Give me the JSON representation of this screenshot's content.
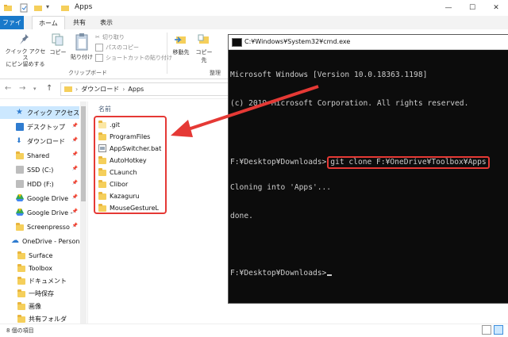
{
  "explorer": {
    "title": "Apps",
    "window_controls": [
      "—",
      "☐",
      "✕"
    ],
    "tabs": [
      "ファイル",
      "ホーム",
      "共有",
      "表示"
    ],
    "ribbon": {
      "pin_label": "クイック アクセス\nにピン留めする",
      "copy_label": "コピー",
      "paste_label": "貼り付け",
      "cut_label": "切り取り",
      "copy_path_label": "パスのコピー",
      "paste_shortcut_label": "ショートカットの貼り付け",
      "move_to_label": "移動先",
      "copy_to_label": "コピー先",
      "clipboard_group": "クリップボード",
      "organize_group": "整理"
    },
    "address": {
      "crumbs": [
        "ダウンロード",
        "Apps"
      ]
    },
    "nav_items": [
      {
        "label": "クイック アクセス",
        "icon": "star-icon",
        "active": true,
        "pinned": false
      },
      {
        "label": "デスクトップ",
        "icon": "desktop-icon",
        "active": false,
        "pinned": true
      },
      {
        "label": "ダウンロード",
        "icon": "download-icon",
        "active": false,
        "pinned": true
      },
      {
        "label": "Shared",
        "icon": "folder-icon",
        "active": false,
        "pinned": true
      },
      {
        "label": "SSD (C:)",
        "icon": "drive-icon",
        "active": false,
        "pinned": true
      },
      {
        "label": "HDD (F:)",
        "icon": "drive-icon",
        "active": false,
        "pinned": true
      },
      {
        "label": "Google Drive",
        "icon": "google-drive-icon",
        "active": false,
        "pinned": true
      },
      {
        "label": "Google Drive -",
        "icon": "google-drive-icon",
        "active": false,
        "pinned": true
      },
      {
        "label": "Screenpresso",
        "icon": "folder-icon",
        "active": false,
        "pinned": true
      },
      {
        "label": "OneDrive - Persona",
        "icon": "cloud-icon",
        "active": false,
        "pinned": false
      },
      {
        "label": "Surface",
        "icon": "folder-icon",
        "active": false,
        "pinned": false
      },
      {
        "label": "Toolbox",
        "icon": "folder-icon",
        "active": false,
        "pinned": false
      },
      {
        "label": "ドキュメント",
        "icon": "folder-icon",
        "active": false,
        "pinned": false
      },
      {
        "label": "一時保存",
        "icon": "folder-icon",
        "active": false,
        "pinned": false
      },
      {
        "label": "画像",
        "icon": "folder-icon",
        "active": false,
        "pinned": false
      },
      {
        "label": "共有フォルダ",
        "icon": "folder-icon",
        "active": false,
        "pinned": false
      }
    ],
    "column_header": "名前",
    "files": [
      {
        "name": ".git",
        "icon": "folder-icon"
      },
      {
        "name": "ProgramFiles",
        "icon": "folder-icon"
      },
      {
        "name": "AppSwitcher.bat",
        "icon": "bat-file-icon"
      },
      {
        "name": "AutoHotkey",
        "icon": "folder-icon"
      },
      {
        "name": "CLaunch",
        "icon": "folder-icon"
      },
      {
        "name": "Clibor",
        "icon": "folder-icon"
      },
      {
        "name": "Kazaguru",
        "icon": "folder-icon"
      },
      {
        "name": "MouseGestureL",
        "icon": "folder-icon"
      }
    ],
    "status": "8 個の項目"
  },
  "console": {
    "title": "C:¥Windows¥System32¥cmd.exe",
    "lines": [
      "Microsoft Windows [Version 10.0.18363.1198]",
      "(c) 2019 Microsoft Corporation. All rights reserved.",
      ""
    ],
    "prompt1": "F:¥Desktop¥Downloads>",
    "command": "git clone F:¥OneDrive¥Toolbox¥Apps",
    "output": [
      "Cloning into 'Apps'...",
      "done."
    ],
    "prompt2": "F:¥Desktop¥Downloads>"
  },
  "colors": {
    "highlight": "#e53935",
    "file_tab": "#1979ca",
    "console_bg": "#0c0c0c",
    "console_fg": "#cccccc"
  }
}
